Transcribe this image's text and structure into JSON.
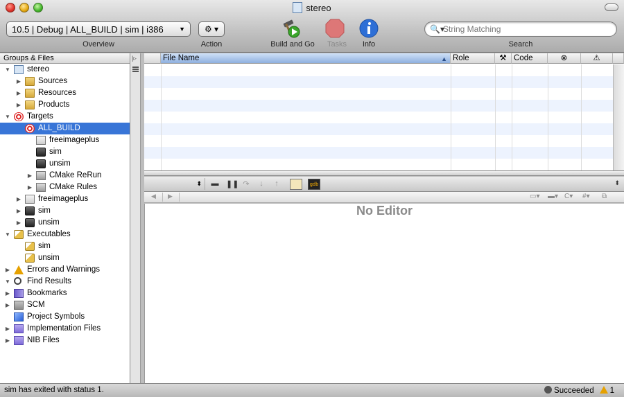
{
  "window": {
    "title": "stereo"
  },
  "toolbar": {
    "overview_value": "10.5 | Debug | ALL_BUILD | sim | i386",
    "overview_label": "Overview",
    "action_label": "Action",
    "action_glyph": "⚙ ▾",
    "build_label": "Build and Go",
    "tasks_label": "Tasks",
    "info_label": "Info",
    "search_placeholder": "String Matching",
    "search_label": "Search"
  },
  "sidebar": {
    "header": "Groups & Files",
    "items": [
      {
        "label": "stereo",
        "depth": 0,
        "disclosure": "▼",
        "icon": "project-icon"
      },
      {
        "label": "Sources",
        "depth": 1,
        "disclosure": "▶",
        "icon": "folder-icon"
      },
      {
        "label": "Resources",
        "depth": 1,
        "disclosure": "▶",
        "icon": "folder-icon"
      },
      {
        "label": "Products",
        "depth": 1,
        "disclosure": "▶",
        "icon": "folder-icon"
      },
      {
        "label": "Targets",
        "depth": 0,
        "disclosure": "▼",
        "icon": "target-icon"
      },
      {
        "label": "ALL_BUILD",
        "depth": 1,
        "disclosure": "",
        "icon": "target-icon",
        "selected": true
      },
      {
        "label": "freeimageplus",
        "depth": 2,
        "disclosure": "",
        "icon": "box-icon"
      },
      {
        "label": "sim",
        "depth": 2,
        "disclosure": "",
        "icon": "terminal-icon"
      },
      {
        "label": "unsim",
        "depth": 2,
        "disclosure": "",
        "icon": "terminal-icon"
      },
      {
        "label": "CMake ReRun",
        "depth": 2,
        "disclosure": "▶",
        "icon": "gray-box-icon"
      },
      {
        "label": "CMake Rules",
        "depth": 2,
        "disclosure": "▶",
        "icon": "gray-box-icon"
      },
      {
        "label": "freeimageplus",
        "depth": 1,
        "disclosure": "▶",
        "icon": "box-icon"
      },
      {
        "label": "sim",
        "depth": 1,
        "disclosure": "▶",
        "icon": "terminal-icon"
      },
      {
        "label": "unsim",
        "depth": 1,
        "disclosure": "▶",
        "icon": "terminal-icon"
      },
      {
        "label": "Executables",
        "depth": 0,
        "disclosure": "▼",
        "icon": "executable-icon"
      },
      {
        "label": "sim",
        "depth": 1,
        "disclosure": "",
        "icon": "executable-icon"
      },
      {
        "label": "unsim",
        "depth": 1,
        "disclosure": "",
        "icon": "executable-icon"
      },
      {
        "label": "Errors and Warnings",
        "depth": 0,
        "disclosure": "▶",
        "icon": "warning-icon"
      },
      {
        "label": "Find Results",
        "depth": 0,
        "disclosure": "▼",
        "icon": "find-icon"
      },
      {
        "label": "Bookmarks",
        "depth": 0,
        "disclosure": "▶",
        "icon": "bookmarks-icon"
      },
      {
        "label": "SCM",
        "depth": 0,
        "disclosure": "▶",
        "icon": "scm-icon"
      },
      {
        "label": "Project Symbols",
        "depth": 0,
        "disclosure": "",
        "icon": "symbols-icon"
      },
      {
        "label": "Implementation Files",
        "depth": 0,
        "disclosure": "▶",
        "icon": "smart-group-icon"
      },
      {
        "label": "NIB Files",
        "depth": 0,
        "disclosure": "▶",
        "icon": "smart-group-icon"
      }
    ]
  },
  "details": {
    "columns": [
      "File Name",
      "Role",
      "Code"
    ],
    "sort_arrow": "▲",
    "build_col_icon": "hammer-icon",
    "errors_col_icon": "error-icon",
    "warnings_col_icon": "warning-icon",
    "row_count": 8
  },
  "debugger": {
    "popup_arrow": "⬍",
    "gdb_label": "gdb"
  },
  "editor": {
    "message": "No Editor",
    "nav_back": "◀",
    "nav_forward": "▶",
    "counterpart_label": "C",
    "includes_label": "#"
  },
  "status": {
    "message": "sim has exited with status 1.",
    "result": "Succeeded",
    "warning_count": "1"
  }
}
